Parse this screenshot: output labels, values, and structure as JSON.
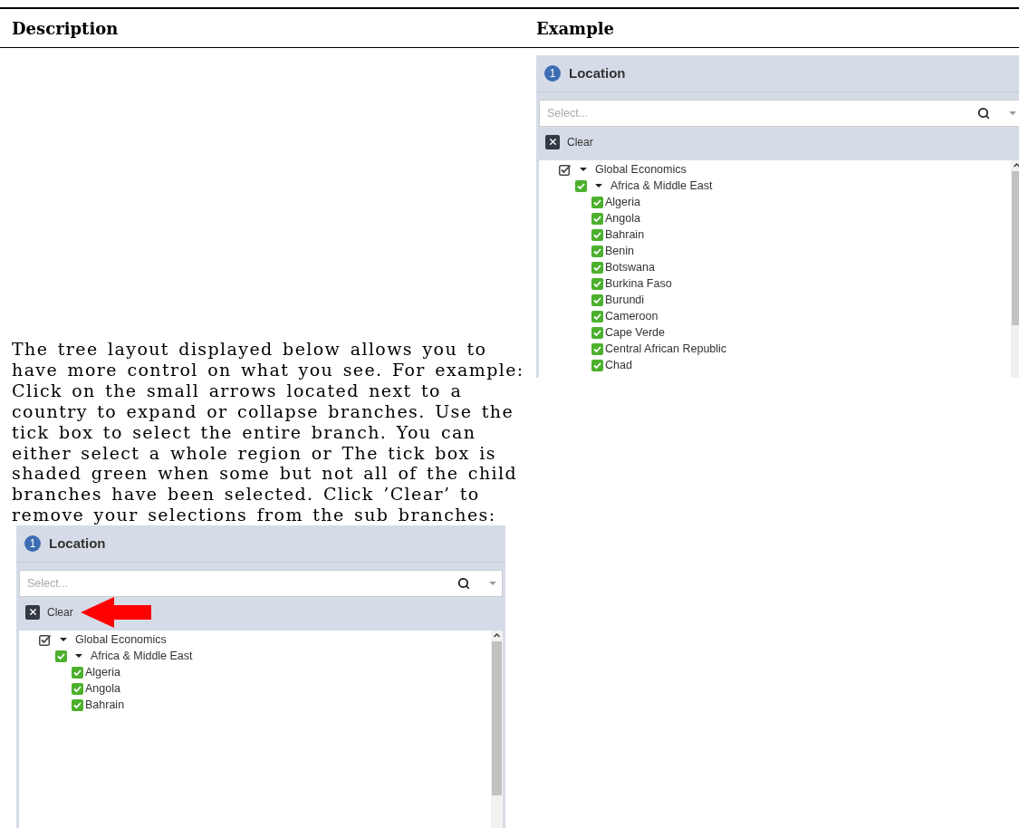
{
  "table": {
    "columns": [
      "Description",
      "Example"
    ]
  },
  "description": "The tree layout displayed below allows you to have more control on what you see. For example: Click on the small arrows located next to a country to expand or collapse branches. Use the tick box to select the entire branch. You can either select a whole region or The tick box is shaded green when some but not all of the child branches have been selected. Click ’Clear’ to remove your selections from the sub branches:",
  "description_panel": {
    "step": "1",
    "title": "Location",
    "search": {
      "placeholder": "Select..."
    },
    "clear": "Clear",
    "arrow_pointer": true,
    "tree": [
      {
        "label": "Global Economics",
        "checked": true,
        "partial": true,
        "expanded": true,
        "children": [
          {
            "label": "Africa & Middle East",
            "checked": true,
            "partial": false,
            "expanded": true,
            "children": [
              {
                "label": "Algeria",
                "checked": true,
                "partial": false
              },
              {
                "label": "Angola",
                "checked": true,
                "partial": false
              },
              {
                "label": "Bahrain",
                "checked": true,
                "partial": false
              }
            ]
          }
        ]
      }
    ]
  },
  "example_panel": {
    "step": "1",
    "title": "Location",
    "search": {
      "placeholder": "Select..."
    },
    "clear": "Clear",
    "arrow_pointer": false,
    "tree": [
      {
        "label": "Global Economics",
        "checked": true,
        "partial": true,
        "expanded": true,
        "children": [
          {
            "label": "Africa & Middle East",
            "checked": true,
            "partial": false,
            "expanded": true,
            "children": [
              {
                "label": "Algeria",
                "checked": true,
                "partial": false
              },
              {
                "label": "Angola",
                "checked": true,
                "partial": false
              },
              {
                "label": "Bahrain",
                "checked": true,
                "partial": false
              },
              {
                "label": "Benin",
                "checked": true,
                "partial": false
              },
              {
                "label": "Botswana",
                "checked": true,
                "partial": false
              },
              {
                "label": "Burkina Faso",
                "checked": true,
                "partial": false
              },
              {
                "label": "Burundi",
                "checked": true,
                "partial": false
              },
              {
                "label": "Cameroon",
                "checked": true,
                "partial": false
              },
              {
                "label": "Cape Verde",
                "checked": true,
                "partial": false
              },
              {
                "label": "Central African Republic",
                "checked": true,
                "partial": false
              },
              {
                "label": "Chad",
                "checked": true,
                "partial": false
              }
            ]
          }
        ]
      }
    ]
  }
}
